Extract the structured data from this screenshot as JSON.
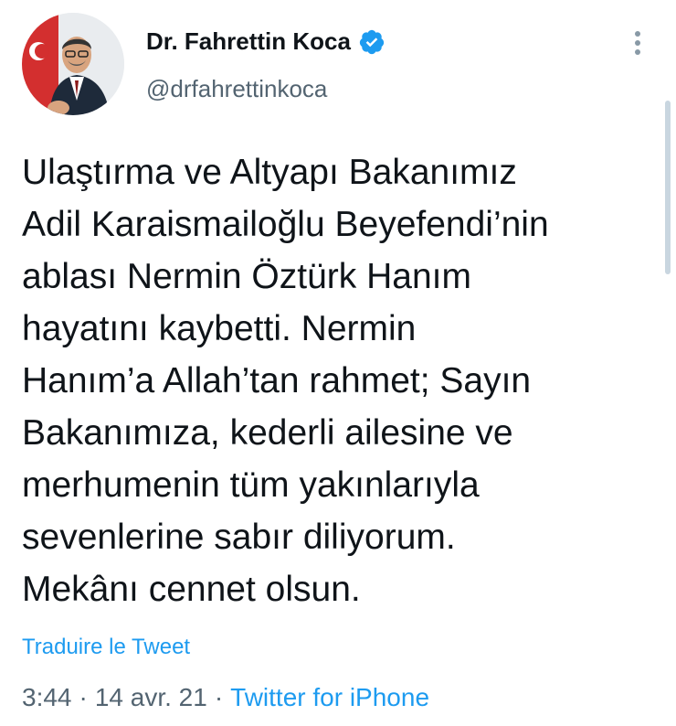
{
  "author": {
    "name": "Dr. Fahrettin Koca",
    "handle": "@drfahrettinkoca",
    "verified": true
  },
  "tweet": {
    "text": "Ulaştırma ve Altyapı Bakanımız\nAdil Karaismailoğlu Beyefendi’nin\nablası Nermin Öztürk Hanım\nhayatını kaybetti. Nermin\nHanım’a Allah’tan rahmet; Sayın\nBakanımıza, kederli ailesine ve\nmerhumenin tüm yakınlarıyla\nsevenlerine sabır diliyorum.\nMekânı cennet olsun.",
    "translate_label": "Traduire le Tweet",
    "time": "3:44",
    "date": "14 avr. 21",
    "source": "Twitter for iPhone",
    "separator": "·"
  },
  "icons": {
    "more": "more-vertical-icon",
    "verified": "verified-badge-icon"
  },
  "colors": {
    "link": "#1d9bf0",
    "secondary_text": "#536471",
    "verified": "#1d9bf0"
  }
}
